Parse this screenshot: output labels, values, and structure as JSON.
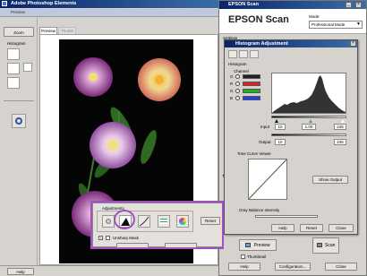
{
  "pse": {
    "title": "Adobe Photoshop Elements",
    "preview_label": "Preview",
    "tabs": [
      "Preview",
      "Thumb"
    ],
    "zoom_label": "Zoom",
    "histogram_label": "Histogram",
    "help_label": "Help"
  },
  "epson": {
    "window_title": "EPSON Scan",
    "logo": "EPSON Scan",
    "mode_label": "Mode:",
    "mode_value": "Professional Mode",
    "settings_label": "Settings",
    "preview_label": "Preview",
    "scan_label": "Scan",
    "thumbnail_label": "Thumbnail",
    "help_label": "Help",
    "configuration_label": "Configuration...",
    "close_label": "Close",
    "side_letters": [
      "D",
      "D",
      "Ta",
      "Ad"
    ]
  },
  "hist": {
    "title": "Histogram Adjustment",
    "histogram_label": "Histogram",
    "channel_label": "Channel",
    "channel_letters": [
      "G",
      "R",
      "G",
      "B"
    ],
    "input_label": "Input",
    "input_values": [
      "10",
      "1.00",
      "245"
    ],
    "output_label": "Output",
    "output_values": [
      "10",
      "245"
    ],
    "tone_curve_label": "Tone Curve Viewer",
    "show_output_label": "Show Output",
    "gray_balance_label": "Gray Balance Intensity",
    "help_label": "Help",
    "reset_label": "Reset",
    "close_label": "Close"
  },
  "adjustments": {
    "title": "Adjustments",
    "reset_label": "Reset",
    "unsharp_label": "Unsharp Mask"
  },
  "colors": {
    "highlight": "#a050c0",
    "title_bar": "#0a246a"
  }
}
